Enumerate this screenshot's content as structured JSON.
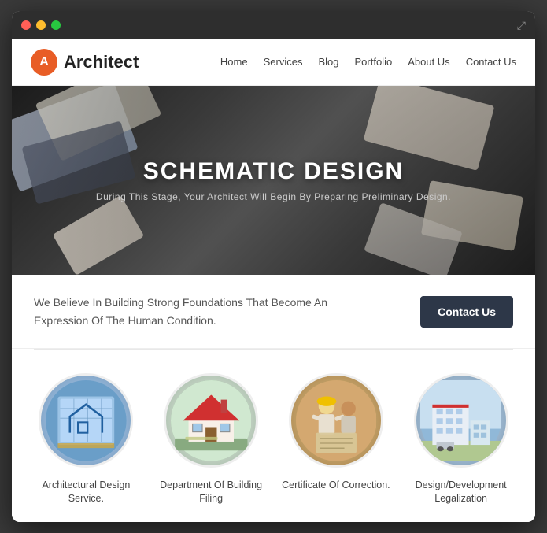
{
  "browser": {
    "traffic_lights": [
      "red",
      "yellow",
      "green"
    ],
    "expand_icon": "⤢"
  },
  "navbar": {
    "logo_letter": "A",
    "brand_name": "Architect",
    "nav_links": [
      {
        "label": "Home",
        "href": "#"
      },
      {
        "label": "Services",
        "href": "#"
      },
      {
        "label": "Blog",
        "href": "#"
      },
      {
        "label": "Portfolio",
        "href": "#"
      },
      {
        "label": "About Us",
        "href": "#"
      },
      {
        "label": "Contact Us",
        "href": "#"
      }
    ]
  },
  "hero": {
    "title": "SCHEMATIC DESIGN",
    "subtitle": "During This Stage, Your Architect Will Begin By Preparing Preliminary Design."
  },
  "tagline": {
    "text": "We Believe In Building Strong Foundations That Become An Expression Of The Human Condition.",
    "contact_button": "Contact Us"
  },
  "services": [
    {
      "id": "architectural-design",
      "label": "Architectural Design Service.",
      "circle_class": "circle-1"
    },
    {
      "id": "building-filing",
      "label": "Department Of Building Filing",
      "circle_class": "circle-2"
    },
    {
      "id": "certificate-correction",
      "label": "Certificate Of Correction.",
      "circle_class": "circle-3"
    },
    {
      "id": "design-development",
      "label": "Design/Development Legalization",
      "circle_class": "circle-4"
    }
  ]
}
